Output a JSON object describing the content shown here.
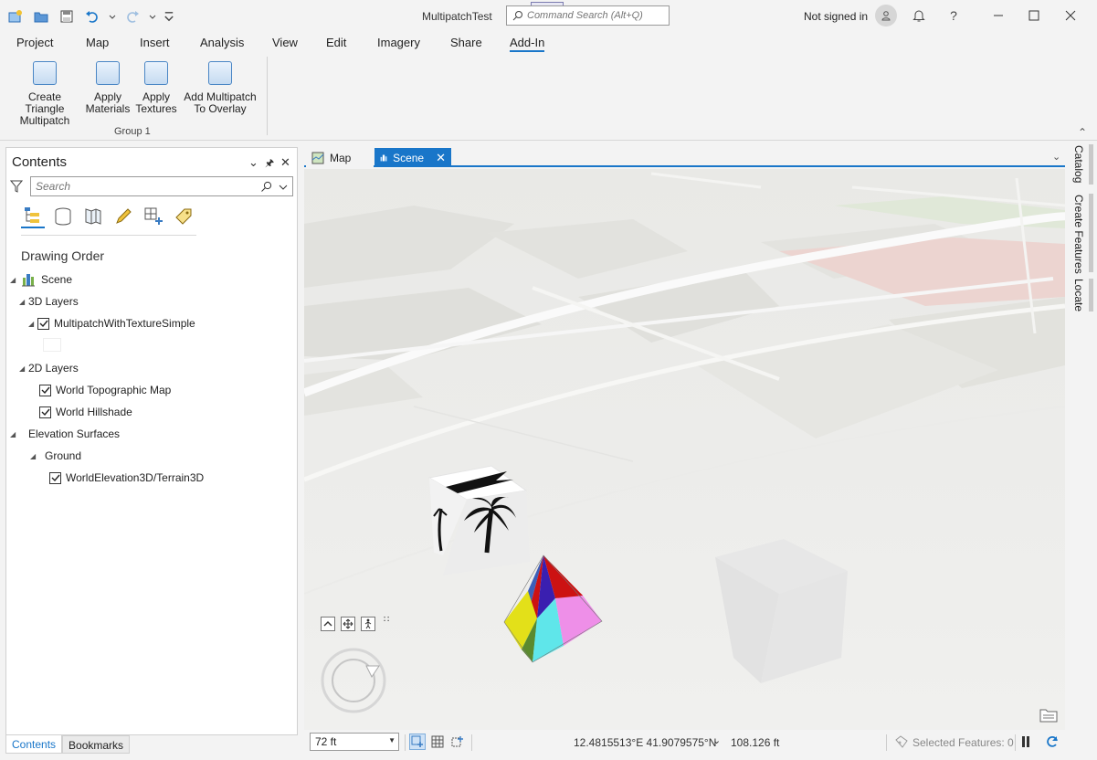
{
  "app": {
    "title": "MultipatchTest",
    "command_search_placeholder": "Command Search (Alt+Q)",
    "sign_in": "Not signed in"
  },
  "ribbon_tabs": [
    "Project",
    "Map",
    "Insert",
    "Analysis",
    "View",
    "Edit",
    "Imagery",
    "Share",
    "Add-In"
  ],
  "active_ribbon_tab": "Add-In",
  "ribbon": {
    "buttons": [
      {
        "line1": "Create Triangle",
        "line2": "Multipatch"
      },
      {
        "line1": "Apply",
        "line2": "Materials"
      },
      {
        "line1": "Apply",
        "line2": "Textures"
      },
      {
        "line1": "Add Multipatch",
        "line2": "To Overlay"
      }
    ],
    "group_label": "Group 1"
  },
  "contents": {
    "title": "Contents",
    "search_placeholder": "Search",
    "heading": "Drawing Order",
    "tree": {
      "scene": "Scene",
      "layers_3d": "3D Layers",
      "multipatch_layer": "MultipatchWithTextureSimple",
      "layers_2d": "2D Layers",
      "topo": "World Topographic Map",
      "hillshade": "World Hillshade",
      "elevation": "Elevation Surfaces",
      "ground": "Ground",
      "terrain": "WorldElevation3D/Terrain3D"
    },
    "bottom_tabs": [
      "Contents",
      "Bookmarks"
    ]
  },
  "view_tabs": [
    {
      "label": "Map",
      "active": false
    },
    {
      "label": "Scene",
      "active": true
    }
  ],
  "status": {
    "scale": "72 ft",
    "coordinates": "12.4815513°E 41.9079575°N",
    "elevation": "108.126 ft",
    "selected_features": "Selected Features: 0"
  },
  "right_dock": [
    "Catalog",
    "Create Features",
    "Locate"
  ],
  "colors": {
    "accent": "#1976c9",
    "pyramid": [
      "#e3e019",
      "#5fe6ea",
      "#ee8fe8",
      "#cc1212",
      "#3a1fb0",
      "#3c5fb8",
      "#5b8a2e"
    ]
  }
}
